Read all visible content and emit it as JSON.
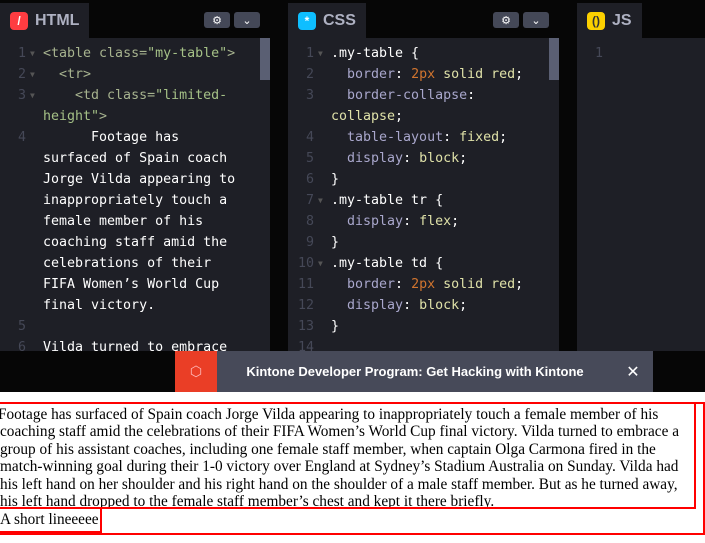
{
  "panels": [
    {
      "title": "HTML",
      "icon": "html-icon",
      "color": "#ff3c41",
      "glyph": "/",
      "lines": [
        {
          "n": "1",
          "fold": true,
          "t": [
            [
              "tag",
              "<table "
            ],
            [
              "tag",
              "class="
            ],
            [
              "str",
              "\"my-table\""
            ],
            [
              "tag",
              ">"
            ]
          ]
        },
        {
          "n": "2",
          "fold": true,
          "t": [
            [
              "tag",
              "  <tr>"
            ]
          ]
        },
        {
          "n": "3",
          "fold": true,
          "t": [
            [
              "tag",
              "    <td "
            ],
            [
              "tag",
              "class="
            ],
            [
              "str",
              "\"limited-"
            ]
          ]
        },
        {
          "n": "",
          "t": [
            [
              "str",
              "height\""
            ],
            [
              "tag",
              ">"
            ]
          ]
        },
        {
          "n": "4",
          "t": [
            [
              "",
              "      Footage has"
            ]
          ]
        },
        {
          "n": "",
          "t": [
            [
              "",
              "surfaced of Spain coach"
            ]
          ]
        },
        {
          "n": "",
          "t": [
            [
              "",
              "Jorge Vilda appearing to"
            ]
          ]
        },
        {
          "n": "",
          "t": [
            [
              "",
              "inappropriately touch a"
            ]
          ]
        },
        {
          "n": "",
          "t": [
            [
              "",
              "female member of his"
            ]
          ]
        },
        {
          "n": "",
          "t": [
            [
              "",
              "coaching staff amid the"
            ]
          ]
        },
        {
          "n": "",
          "t": [
            [
              "",
              "celebrations of their"
            ]
          ]
        },
        {
          "n": "",
          "t": [
            [
              "",
              "FIFA Women’s World Cup"
            ]
          ]
        },
        {
          "n": "",
          "t": [
            [
              "",
              "final victory."
            ]
          ]
        },
        {
          "n": "5",
          "t": []
        },
        {
          "n": "6",
          "t": [
            [
              "",
              "Vilda turned to embrace"
            ]
          ]
        }
      ]
    },
    {
      "title": "CSS",
      "icon": "css-icon",
      "color": "#0ebeff",
      "glyph": "*",
      "lines": [
        {
          "n": "1",
          "fold": true,
          "t": [
            [
              "sel",
              ".my-table {"
            ]
          ]
        },
        {
          "n": "2",
          "t": [
            [
              "prop",
              "  border"
            ],
            [
              "sel",
              ": "
            ],
            [
              "numv",
              "2px"
            ],
            [
              "val",
              " solid red"
            ],
            [
              "sel",
              ";"
            ]
          ]
        },
        {
          "n": "3",
          "t": [
            [
              "prop",
              "  border-collapse"
            ],
            [
              "sel",
              ":"
            ]
          ]
        },
        {
          "n": "",
          "t": [
            [
              "val",
              "collapse"
            ],
            [
              "sel",
              ";"
            ]
          ]
        },
        {
          "n": "4",
          "t": [
            [
              "prop",
              "  table-layout"
            ],
            [
              "sel",
              ": "
            ],
            [
              "val",
              "fixed"
            ],
            [
              "sel",
              ";"
            ]
          ]
        },
        {
          "n": "5",
          "t": [
            [
              "prop",
              "  display"
            ],
            [
              "sel",
              ": "
            ],
            [
              "val",
              "block"
            ],
            [
              "sel",
              ";"
            ]
          ]
        },
        {
          "n": "6",
          "t": [
            [
              "sel",
              "}"
            ]
          ]
        },
        {
          "n": "7",
          "fold": true,
          "t": [
            [
              "sel",
              ".my-table tr {"
            ]
          ]
        },
        {
          "n": "8",
          "t": [
            [
              "prop",
              "  display"
            ],
            [
              "sel",
              ": "
            ],
            [
              "val",
              "flex"
            ],
            [
              "sel",
              ";"
            ]
          ]
        },
        {
          "n": "9",
          "t": [
            [
              "sel",
              "}"
            ]
          ]
        },
        {
          "n": "10",
          "fold": true,
          "t": [
            [
              "sel",
              ".my-table td {"
            ]
          ]
        },
        {
          "n": "11",
          "t": [
            [
              "prop",
              "  border"
            ],
            [
              "sel",
              ": "
            ],
            [
              "numv",
              "2px"
            ],
            [
              "val",
              " solid red"
            ],
            [
              "sel",
              ";"
            ]
          ]
        },
        {
          "n": "12",
          "t": [
            [
              "prop",
              "  display"
            ],
            [
              "sel",
              ": "
            ],
            [
              "val",
              "block"
            ],
            [
              "sel",
              ";"
            ]
          ]
        },
        {
          "n": "13",
          "t": [
            [
              "sel",
              "}"
            ]
          ]
        },
        {
          "n": "14",
          "t": []
        }
      ]
    },
    {
      "title": "JS",
      "icon": "js-icon",
      "color": "#fcd000",
      "glyph": "()",
      "lines": [
        {
          "n": "1",
          "t": []
        }
      ]
    }
  ],
  "ad": {
    "text": "Kintone Developer Program: Get Hacking with Kintone",
    "close": "✕",
    "icon": "kintone-logo-icon"
  },
  "preview": {
    "cell1": "Footage has surfaced of Spain coach Jorge Vilda appearing to inappropriately touch a female member of his coaching staff amid the celebrations of their FIFA Women’s World Cup final victory. Vilda turned to embrace a group of his assistant coaches, including one female staff member, when captain Olga Carmona fired in the match-winning goal during their 1-0 victory over England at Sydney’s Stadium Australia on Sunday. Vilda had his left hand on her shoulder and his right hand on the shoulder of a male staff member. But as he turned away, his left hand dropped to the female staff member’s chest and kept it there briefly.",
    "cell2": "A short lineeeee"
  }
}
